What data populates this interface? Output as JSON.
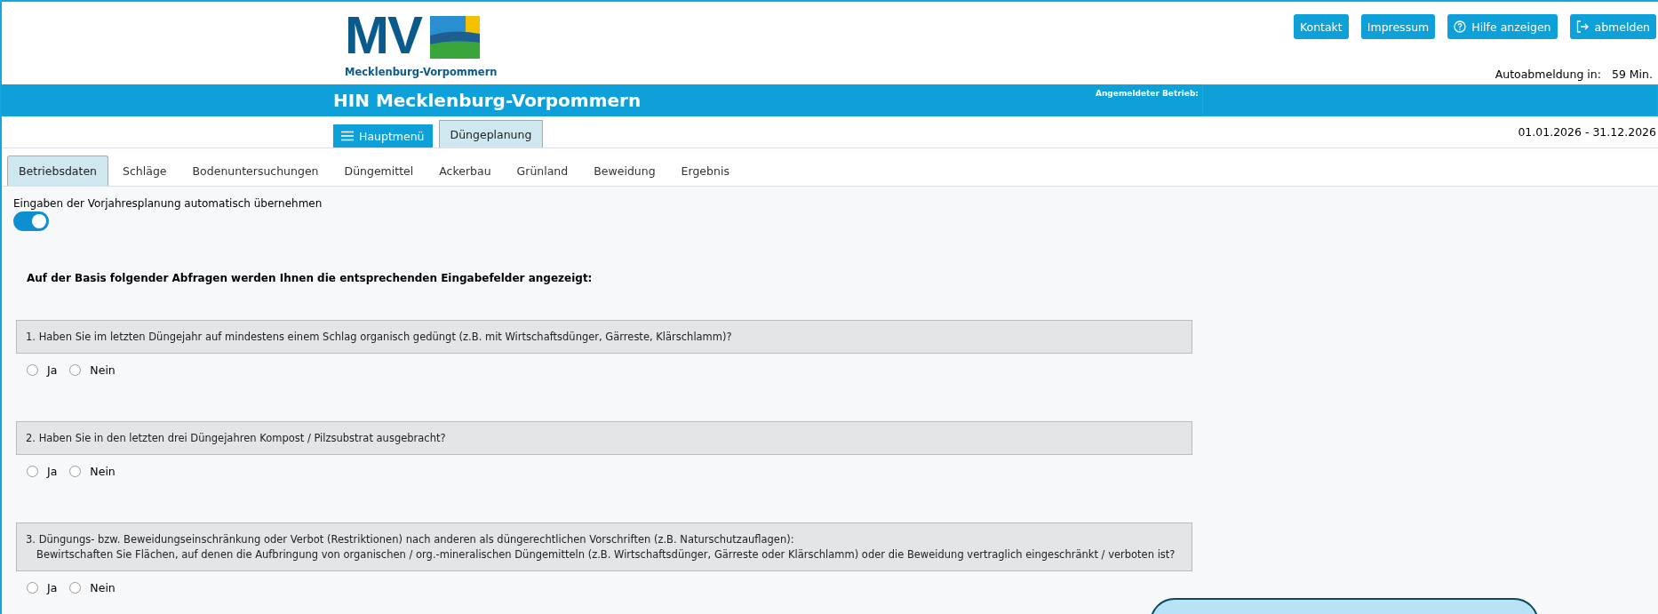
{
  "logo": {
    "initials": "MV",
    "caption": "Mecklenburg-Vorpommern"
  },
  "header_buttons": [
    {
      "label": "Kontakt",
      "kind": "link"
    },
    {
      "label": "Impressum",
      "kind": "link"
    },
    {
      "label": "Hilfe anzeigen",
      "kind": "help"
    },
    {
      "label": "abmelden",
      "kind": "logout"
    }
  ],
  "auto_logout": {
    "label": "Autoabmeldung in:",
    "value": "59 Min."
  },
  "title": "HIN Mecklenburg-Vorpommern",
  "company_label": "Angemeldeter Betrieb:",
  "main_menu_button": "Hauptmenü",
  "module_tab": "Düngeplanung",
  "period": "01.01.2026 - 31.12.2026",
  "tabs": [
    {
      "label": "Betriebsdaten",
      "selected": true
    },
    {
      "label": "Schläge",
      "selected": false
    },
    {
      "label": "Bodenuntersuchungen",
      "selected": false
    },
    {
      "label": "Düngemittel",
      "selected": false
    },
    {
      "label": "Ackerbau",
      "selected": false
    },
    {
      "label": "Grünland",
      "selected": false
    },
    {
      "label": "Beweidung",
      "selected": false
    },
    {
      "label": "Ergebnis",
      "selected": false
    }
  ],
  "toggle": {
    "label": "Eingaben der Vorjahresplanung automatisch übernehmen",
    "on": true
  },
  "heading": "Auf der Basis folgender Abfragen werden Ihnen die entsprechenden Eingabefelder angezeigt:",
  "questions": [
    {
      "lines": [
        "1. Haben Sie im letzten Düngejahr auf mindestens einem Schlag organisch gedüngt (z.B. mit Wirtschaftsdünger, Gärreste, Klärschlamm)?"
      ],
      "options": [
        {
          "label": "Ja",
          "selected": false
        },
        {
          "label": "Nein",
          "selected": false
        }
      ]
    },
    {
      "lines": [
        "2. Haben Sie in den letzten drei Düngejahren Kompost / Pilzsubstrat ausgebracht?"
      ],
      "options": [
        {
          "label": "Ja",
          "selected": false
        },
        {
          "label": "Nein",
          "selected": false
        }
      ]
    },
    {
      "lines": [
        "3. Düngungs- bzw. Beweidungseinschränkung oder Verbot (Restriktionen) nach anderen als düngerechtlichen Vorschriften (z.B. Naturschutzauflagen):",
        "Bewirtschaften Sie Flächen, auf denen die Aufbringung von organischen / org.-mineralischen Düngemitteln (z.B. Wirtschaftsdünger, Gärreste oder Klärschlamm) oder die Beweidung vertraglich eingeschränkt / verboten ist?"
      ],
      "options": [
        {
          "label": "Ja",
          "selected": false
        },
        {
          "label": "Nein",
          "selected": false
        }
      ]
    }
  ]
}
